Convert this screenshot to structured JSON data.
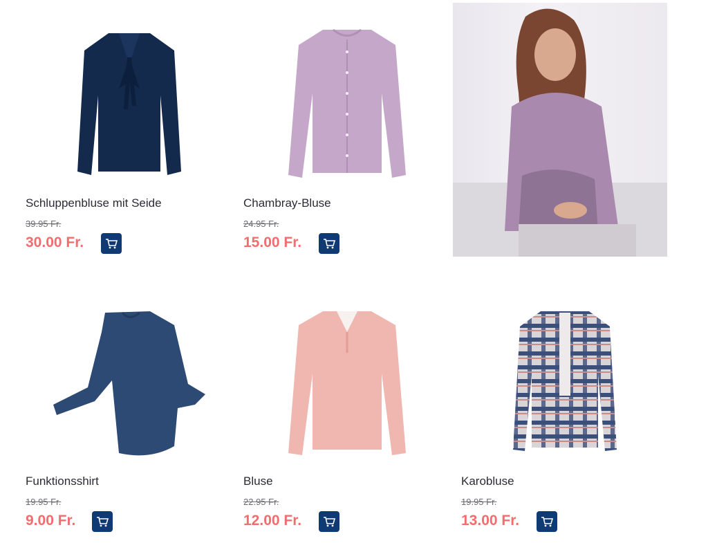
{
  "products": [
    {
      "name": "Schluppenbluse mit Seide",
      "old_price": "39.95 Fr.",
      "price": "30.00 Fr.",
      "image": "navy-bow-blouse"
    },
    {
      "name": "Chambray-Bluse",
      "old_price": "24.95 Fr.",
      "price": "15.00 Fr.",
      "image": "lilac-chambray-blouse"
    },
    {
      "name": "Funktionsshirt",
      "old_price": "19.95 Fr.",
      "price": "9.00 Fr.",
      "image": "navy-longsleeve-shirt"
    },
    {
      "name": "Bluse",
      "old_price": "22.95 Fr.",
      "price": "12.00 Fr.",
      "image": "pink-dotted-blouse"
    },
    {
      "name": "Karobluse",
      "old_price": "19.95 Fr.",
      "price": "13.00 Fr.",
      "image": "plaid-ruffle-blouse"
    }
  ],
  "promo": {
    "image": "model-in-lilac-blouse"
  },
  "colors": {
    "price": "#f26d6d",
    "cart": "#0f3a74",
    "navy": "#142a4d",
    "lilac": "#c5a8c9",
    "pink": "#efb7b0"
  },
  "icons": {
    "cart": "shopping-cart-icon"
  }
}
